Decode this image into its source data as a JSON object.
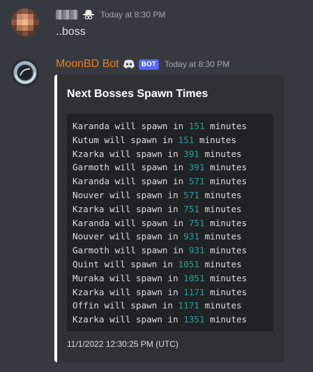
{
  "messages": [
    {
      "author_hidden": true,
      "timestamp": "Today at 8:30 PM",
      "content": "..boss"
    },
    {
      "author": "MoonBD Bot",
      "bot_tag": "BOT",
      "timestamp": "Today at 8:30 PM",
      "embed": {
        "title": "Next Bosses Spawn Times",
        "lines": [
          {
            "boss": "Karanda",
            "text": " will spawn in ",
            "minutes": "151",
            "unit": " minutes"
          },
          {
            "boss": "Kutum",
            "text": " will spawn in ",
            "minutes": "151",
            "unit": " minutes"
          },
          {
            "boss": "Kzarka",
            "text": " will spawn in ",
            "minutes": "391",
            "unit": " minutes"
          },
          {
            "boss": "Garmoth",
            "text": " will spawn in ",
            "minutes": "391",
            "unit": " minutes"
          },
          {
            "boss": "Karanda",
            "text": " will spawn in ",
            "minutes": "571",
            "unit": " minutes"
          },
          {
            "boss": "Nouver",
            "text": " will spawn in ",
            "minutes": "571",
            "unit": " minutes"
          },
          {
            "boss": "Kzarka",
            "text": " will spawn in ",
            "minutes": "751",
            "unit": " minutes"
          },
          {
            "boss": "Karanda",
            "text": " will spawn in ",
            "minutes": "751",
            "unit": " minutes"
          },
          {
            "boss": "Nouver",
            "text": " will spawn in ",
            "minutes": "931",
            "unit": " minutes"
          },
          {
            "boss": "Garmoth",
            "text": " will spawn in ",
            "minutes": "931",
            "unit": " minutes"
          },
          {
            "boss": "Quint",
            "text": " will spawn in ",
            "minutes": "1051",
            "unit": " minutes"
          },
          {
            "boss": "Muraka",
            "text": " will spawn in ",
            "minutes": "1051",
            "unit": " minutes"
          },
          {
            "boss": "Kzarka",
            "text": " will spawn in ",
            "minutes": "1171",
            "unit": " minutes"
          },
          {
            "boss": "Offin",
            "text": " will spawn in ",
            "minutes": "1171",
            "unit": " minutes"
          },
          {
            "boss": "Kzarka",
            "text": " will spawn in ",
            "minutes": "1351",
            "unit": " minutes"
          }
        ],
        "footer": "11/1/2022 12:30:25 PM (UTC)"
      }
    }
  ],
  "colors": {
    "background": "#36393f",
    "bot_name": "#e67e22",
    "bot_tag": "#5865f2",
    "embed_bg": "#2f3136",
    "code_bg": "#202225",
    "number": "#2aa198"
  },
  "icons": {
    "user_badge": "hat-icon",
    "bot_badge": "discord-icon",
    "bot_avatar": "moon-ring-icon"
  }
}
